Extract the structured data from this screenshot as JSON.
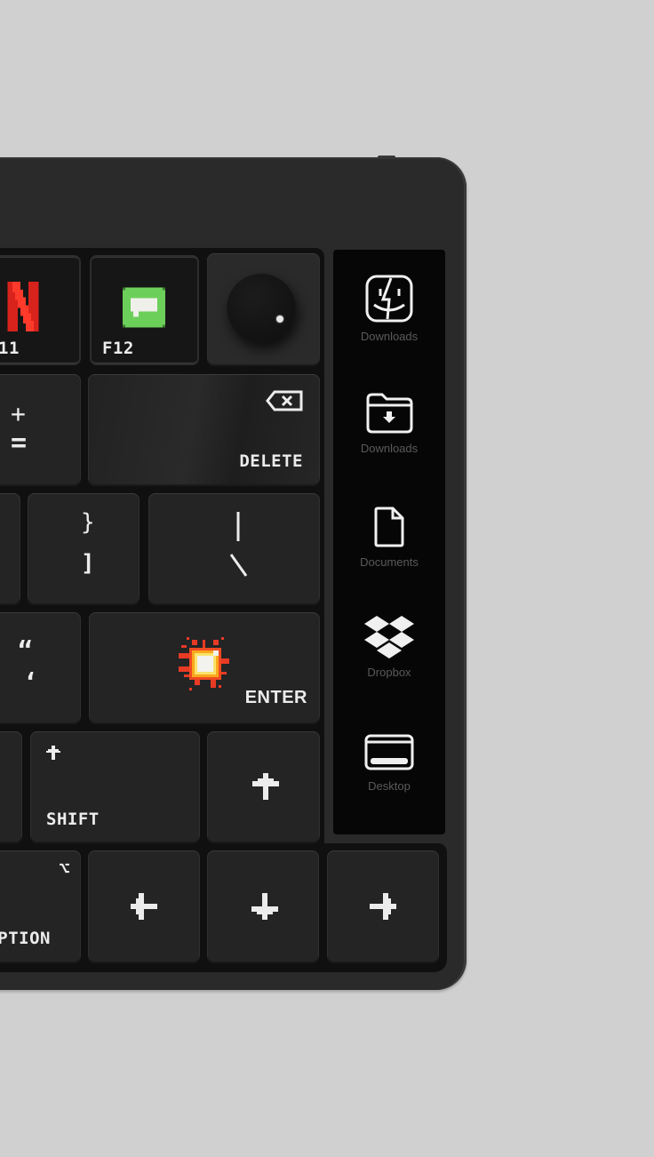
{
  "keyboard": {
    "row1": {
      "f11_label": "11",
      "f12_label": "F12",
      "f11_icon": "netflix-icon",
      "f12_icon": "messages-icon",
      "knob": "volume-knob"
    },
    "row2": {
      "equals_top": "+",
      "equals_bottom": "=",
      "delete_label": "DELETE",
      "delete_icon": "backspace-icon"
    },
    "row3": {
      "bracket_top": "}",
      "bracket_bottom": "]",
      "backslash_top": "|",
      "backslash_bottom": "\\"
    },
    "row4": {
      "quote_top": "“",
      "quote_bottom": "‘",
      "enter_label": "ENTER",
      "enter_icon": "explosion-icon"
    },
    "row5": {
      "shift_label": "SHIFT",
      "shift_icon": "shift-arrow-icon",
      "up_icon": "arrow-up-icon"
    },
    "row6": {
      "option_label": "PTION",
      "option_symbol": "⌥",
      "left_icon": "arrow-left-icon",
      "down_icon": "arrow-down-icon",
      "right_icon": "arrow-right-icon"
    }
  },
  "panel": {
    "items": [
      {
        "label": "Downloads",
        "icon": "finder-icon"
      },
      {
        "label": "Downloads",
        "icon": "downloads-folder-icon"
      },
      {
        "label": "Documents",
        "icon": "document-icon"
      },
      {
        "label": "Dropbox",
        "icon": "dropbox-icon"
      },
      {
        "label": "Desktop",
        "icon": "desktop-icon"
      }
    ]
  },
  "colors": {
    "background": "#d0d0d0",
    "body": "#2a2a2b",
    "key": "#242425",
    "netflix_red": "#e5281e",
    "messages_green": "#6ccf5a"
  }
}
